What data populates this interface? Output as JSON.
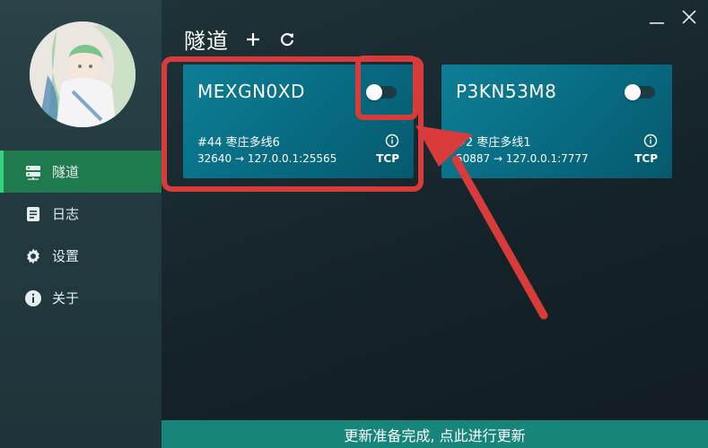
{
  "sidebar": {
    "items": [
      {
        "label": "隧道",
        "icon": "server-icon",
        "active": true
      },
      {
        "label": "日志",
        "icon": "document-icon",
        "active": false
      },
      {
        "label": "设置",
        "icon": "gear-icon",
        "active": false
      },
      {
        "label": "关于",
        "icon": "info-icon",
        "active": false
      }
    ]
  },
  "header": {
    "title": "隧道",
    "add_icon": "plus-icon",
    "refresh_icon": "refresh-icon"
  },
  "window": {
    "minimize_icon": "minimize-icon",
    "close_icon": "close-icon"
  },
  "tunnels": [
    {
      "name": "MEXGN0XD",
      "enabled": false,
      "id_node": "#44 枣庄多线6",
      "mapping": "32640 → 127.0.0.1:25565",
      "protocol": "TCP"
    },
    {
      "name": "P3KN53M8",
      "enabled": false,
      "id_node": "#2 枣庄多线1",
      "mapping": "50887 → 127.0.0.1:7777",
      "protocol": "TCP"
    }
  ],
  "update_bar": {
    "text": "更新准备完成, 点此进行更新"
  },
  "colors": {
    "sidebar_active": "#1f7a4e",
    "card": "#087488",
    "update_bar": "#17857a",
    "annotation": "#d93a3a"
  }
}
